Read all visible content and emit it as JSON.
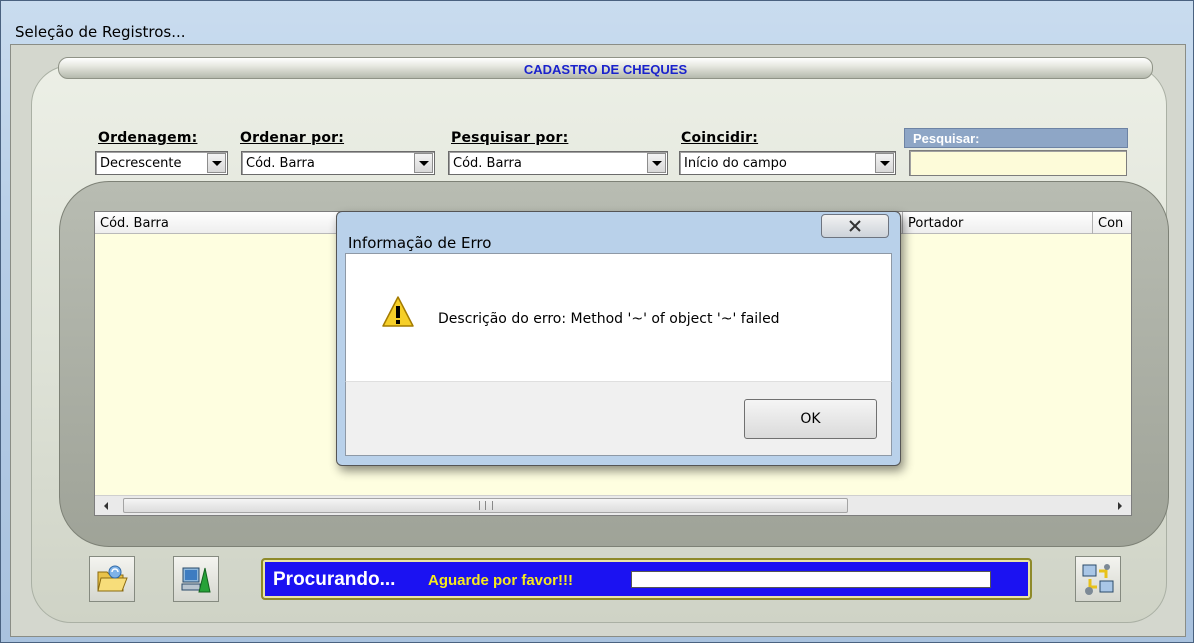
{
  "window": {
    "title": "Seleção de Registros..."
  },
  "header": {
    "title": "CADASTRO DE CHEQUES"
  },
  "filters": {
    "ordenagem": {
      "label": "Ordenagem:",
      "value": "Decrescente"
    },
    "ordenar_por": {
      "label": "Ordenar por:",
      "value": "Cód. Barra"
    },
    "pesquisar_por": {
      "label": "Pesquisar por:",
      "value": "Cód. Barra"
    },
    "coincidir": {
      "label": "Coincidir:",
      "value": "Início do campo"
    },
    "pesquisar": {
      "label": "Pesquisar:",
      "value": ""
    }
  },
  "grid": {
    "columns": [
      "Cód. Barra",
      "Portador",
      "Con"
    ],
    "rows": []
  },
  "toolbar": {
    "open_icon": "folder-open-icon",
    "computer_icon": "computer-icon",
    "exchange_icon": "exchange-icon"
  },
  "status": {
    "main": "Procurando...",
    "sub": "Aguarde por favor!!!",
    "progress": 0
  },
  "dialog": {
    "title": "Informação de Erro",
    "message": "Descrição do erro: Method '~' of object '~' failed",
    "ok_label": "OK",
    "icon": "warning-icon"
  },
  "colors": {
    "header_title": "#1a22cc",
    "status_bg": "#1b12f2",
    "status_sub": "#f6ea1d",
    "grid_bg": "#fefee0",
    "search_head": "#8ea6c6"
  }
}
